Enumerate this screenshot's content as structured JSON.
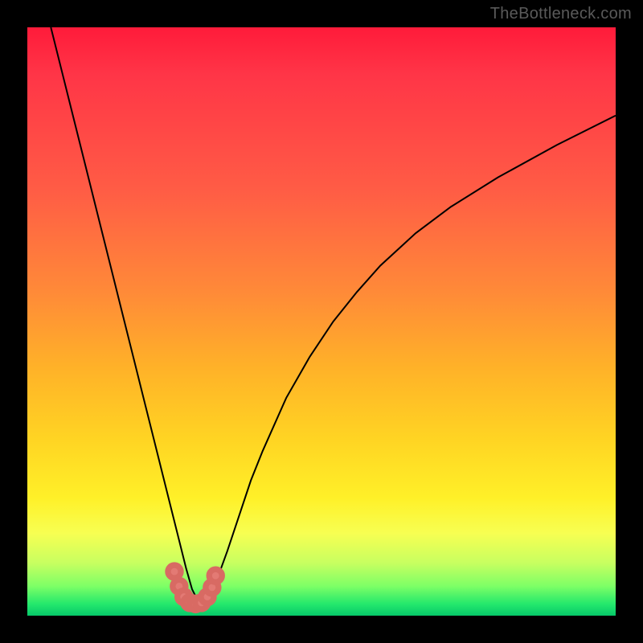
{
  "watermark": "TheBottleneck.com",
  "chart_data": {
    "type": "line",
    "title": "",
    "xlabel": "",
    "ylabel": "",
    "xlim": [
      0,
      100
    ],
    "ylim": [
      0,
      100
    ],
    "note": "Axes are unlabeled in the original. Values are pixel-fraction percentages (0 = left/top, 100 = right/bottom of plot area).",
    "series": [
      {
        "name": "bottleneck-curve",
        "x": [
          4,
          6,
          8,
          10,
          12,
          14,
          16,
          18,
          20,
          22,
          24,
          25,
          26,
          27,
          28,
          29,
          30,
          31,
          32,
          34,
          36,
          38,
          40,
          44,
          48,
          52,
          56,
          60,
          66,
          72,
          80,
          90,
          100
        ],
        "y": [
          0,
          8,
          16,
          24,
          32,
          40,
          48,
          56,
          64,
          72,
          80,
          84,
          88,
          92,
          95.5,
          97.5,
          97.8,
          96.8,
          94.5,
          89,
          83,
          77,
          72,
          63,
          56,
          50,
          45,
          40.5,
          35,
          30.5,
          25.5,
          20,
          15
        ]
      }
    ],
    "scatter": {
      "name": "bottom-cluster",
      "x": [
        25.0,
        25.8,
        26.6,
        27.6,
        28.6,
        29.6,
        30.6,
        31.4,
        32.0
      ],
      "y": [
        92.5,
        95.0,
        96.8,
        97.8,
        98.0,
        97.8,
        96.8,
        95.2,
        93.2
      ]
    },
    "gradient_stops": [
      {
        "pct": 0,
        "color": "#ff1b3a"
      },
      {
        "pct": 28,
        "color": "#ff5d45"
      },
      {
        "pct": 58,
        "color": "#ffb228"
      },
      {
        "pct": 80,
        "color": "#fff028"
      },
      {
        "pct": 95,
        "color": "#7dff66"
      },
      {
        "pct": 100,
        "color": "#06c96a"
      }
    ]
  }
}
